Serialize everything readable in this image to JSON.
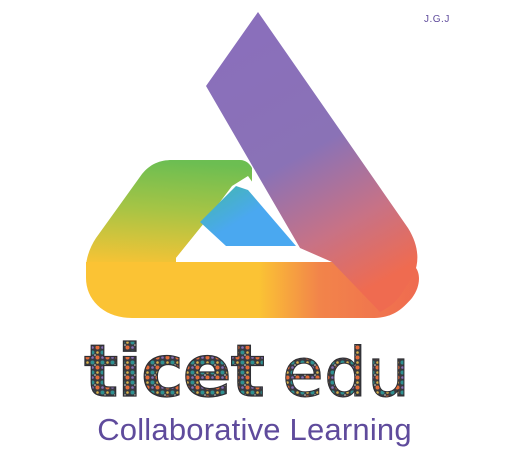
{
  "logo": {
    "corner_mark": "J.G.J",
    "brand_primary": "ticet",
    "brand_secondary": "edu",
    "tagline": "Collaborative Learning"
  },
  "colors": {
    "purple": "#8a6fbb",
    "coral": "#ef6b50",
    "yellow": "#fbc334",
    "green": "#6cbe52",
    "blue": "#4aa8f0",
    "text_dark": "#2f2f33",
    "text_purple": "#5f4b9c",
    "pattern_teal": "#2f8f90",
    "pattern_orange": "#e36c3a"
  },
  "icons": {
    "emblem": "triangle-loop-logo-icon"
  }
}
